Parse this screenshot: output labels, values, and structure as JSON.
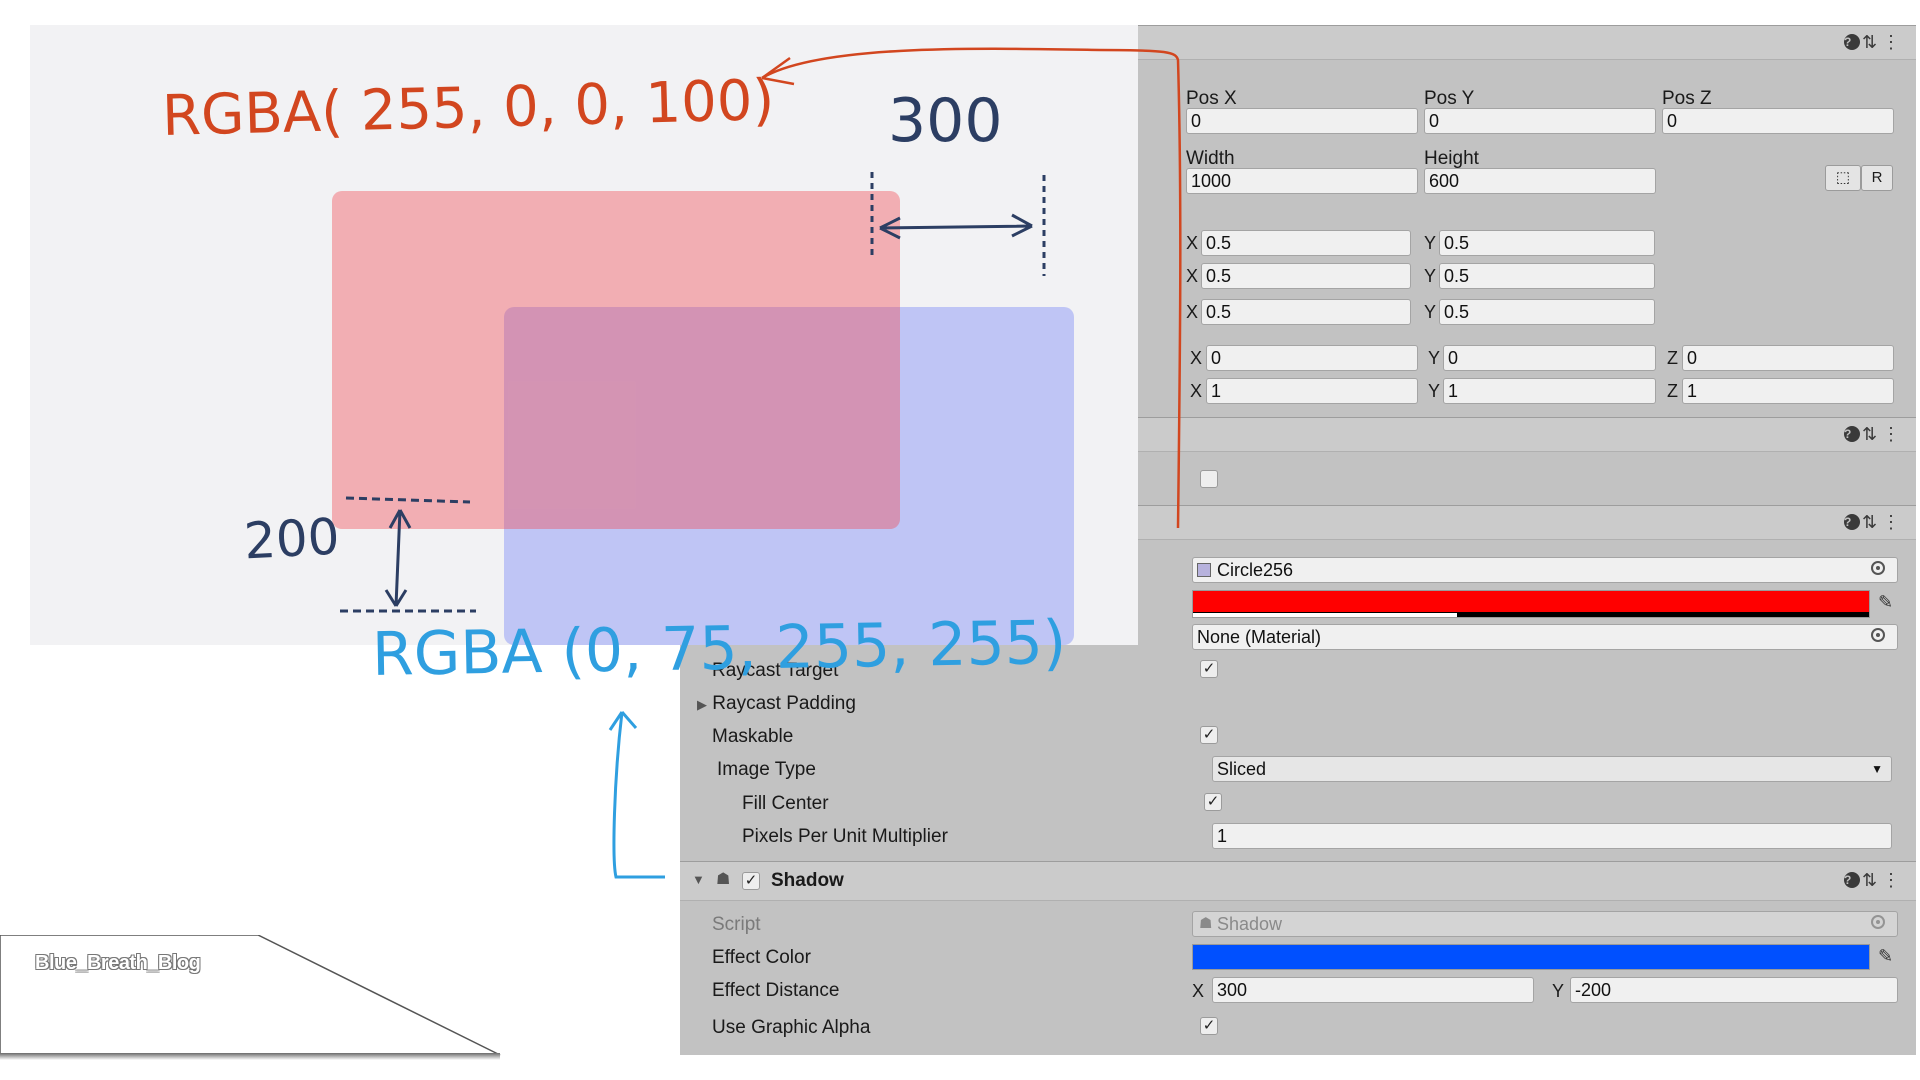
{
  "rect_transform": {
    "pos_x_label": "Pos X",
    "pos_y_label": "Pos Y",
    "pos_z_label": "Pos Z",
    "pos_x": "0",
    "pos_y": "0",
    "pos_z": "0",
    "width_label": "Width",
    "height_label": "Height",
    "width": "1000",
    "height": "600",
    "blueprint_btn": "⬚",
    "raw_btn": "R",
    "anchor_min": {
      "x": "0.5",
      "y": "0.5"
    },
    "anchor_max": {
      "x": "0.5",
      "y": "0.5"
    },
    "pivot": {
      "x": "0.5",
      "y": "0.5"
    },
    "rotation": {
      "x": "0",
      "y": "0",
      "z": "0"
    },
    "scale": {
      "x": "1",
      "y": "1",
      "z": "1"
    },
    "axis_x": "X",
    "axis_y": "Y",
    "axis_z": "Z"
  },
  "image": {
    "source_image": "Circle256",
    "source_icon": "sprite-icon",
    "color_hex": "#ff0000",
    "color_alpha_fraction": 0.39,
    "material": "None (Material)",
    "raycast_target_label": "Raycast Target",
    "raycast_padding_label": "Raycast Padding",
    "maskable_label": "Maskable",
    "image_type_label": "Image Type",
    "image_type_value": "Sliced",
    "fill_center_label": "Fill Center",
    "pixels_per_unit_label": "Pixels Per Unit Multiplier",
    "pixels_per_unit_value": "1"
  },
  "shadow": {
    "title": "Shadow",
    "script_label": "Script",
    "script_value": "Shadow",
    "effect_color_label": "Effect Color",
    "effect_color_hex": "#0050ff",
    "effect_distance_label": "Effect Distance",
    "effect_distance_x": "300",
    "effect_distance_y": "-200",
    "use_graphic_alpha_label": "Use Graphic Alpha"
  },
  "header_icons": {
    "help": "?",
    "settings": "⇅",
    "menu": "⋮"
  },
  "check_mark": "✓",
  "annotations": {
    "red_rgba": "RGBA( 255, 0, 0, 100)",
    "blue_rgba": "RGBA (0, 75, 255, 255)",
    "offset_x": "300",
    "offset_y": "200",
    "color_red": "#d2461f",
    "color_blue": "#2f9fe0",
    "color_dark": "#2c3e63"
  },
  "watermark": "Blue_Breath_Blog"
}
